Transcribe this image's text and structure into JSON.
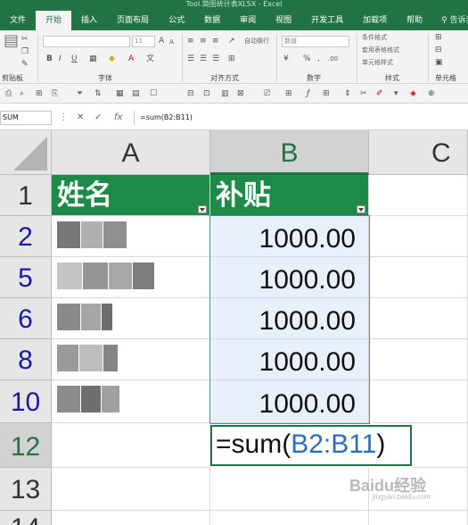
{
  "window": {
    "title": "Tool.简图统计表XLSX - Excel"
  },
  "ribbon": {
    "tabs": [
      "文件",
      "开始",
      "插入",
      "页面布局",
      "公式",
      "数据",
      "审阅",
      "视图",
      "开发工具",
      "加载项",
      "帮助"
    ],
    "active_tab": "开始",
    "tell_me": "告诉我你想要做什么",
    "groups": {
      "clipboard": "剪贴板",
      "font": "字体",
      "alignment": "对齐方式",
      "number": "数字",
      "styles": "样式",
      "cells": "单元格"
    },
    "number_format": "数值",
    "font_size": "11",
    "styles_items": [
      "条件格式",
      "套用表格格式",
      "单元格样式"
    ],
    "wrap_text": "自动换行"
  },
  "formula_bar": {
    "name_box": "SUM",
    "formula": "=sum(B2:B11)",
    "fx_label": "fx"
  },
  "sheet": {
    "columns": [
      "A",
      "B",
      "C"
    ],
    "selected_column": "B",
    "header_row": {
      "row_label": "1",
      "col_a": "姓名",
      "col_b": "补贴"
    },
    "rows": [
      {
        "row_label": "2",
        "value": "1000.00"
      },
      {
        "row_label": "5",
        "value": "1000.00"
      },
      {
        "row_label": "6",
        "value": "1000.00"
      },
      {
        "row_label": "8",
        "value": "1000.00"
      },
      {
        "row_label": "10",
        "value": "1000.00"
      }
    ],
    "edit_row": {
      "row_label": "12",
      "formula_prefix": "=sum(",
      "formula_ref": "B2:B11",
      "formula_suffix": ")"
    },
    "extra_rows": [
      "13",
      "14"
    ]
  },
  "watermark": {
    "text": "Baidu经验",
    "sub": "jingyan.baidu.com"
  }
}
